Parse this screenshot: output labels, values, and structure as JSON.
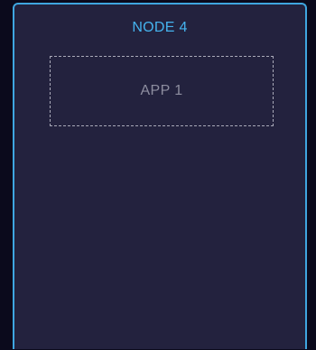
{
  "node": {
    "title": "NODE 4",
    "apps": [
      {
        "label": "APP 1"
      }
    ]
  },
  "colors": {
    "background": "#0b0a1c",
    "card": "#23223e",
    "accent": "#3fa6e0",
    "title": "#45b3ee",
    "app_border": "#a9a9b8",
    "app_text": "#8e8ea0"
  }
}
